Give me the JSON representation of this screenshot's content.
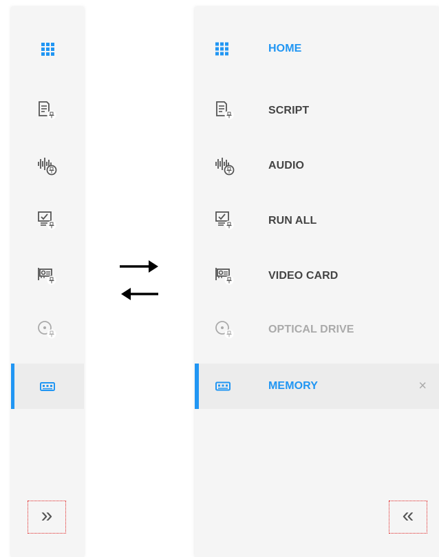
{
  "collapsed_sidebar": {
    "items": [
      {
        "icon": "grid-icon"
      },
      {
        "icon": "script-icon"
      },
      {
        "icon": "audio-icon"
      },
      {
        "icon": "run-all-icon"
      },
      {
        "icon": "video-card-icon"
      },
      {
        "icon": "optical-drive-icon"
      },
      {
        "icon": "memory-icon",
        "active": true
      }
    ],
    "toggle": {
      "glyph": "»",
      "icon": "expand-icon"
    }
  },
  "expanded_sidebar": {
    "items": [
      {
        "label": "HOME",
        "icon": "grid-icon"
      },
      {
        "label": "SCRIPT",
        "icon": "script-icon"
      },
      {
        "label": "AUDIO",
        "icon": "audio-icon"
      },
      {
        "label": "RUN ALL",
        "icon": "run-all-icon"
      },
      {
        "label": "VIDEO CARD",
        "icon": "video-card-icon"
      },
      {
        "label": "OPTICAL DRIVE",
        "icon": "optical-drive-icon",
        "disabled": true
      },
      {
        "label": "MEMORY",
        "icon": "memory-icon",
        "active": true,
        "close": "×"
      }
    ],
    "toggle": {
      "glyph": "«",
      "icon": "collapse-icon"
    }
  },
  "colors": {
    "accent": "#2196f3",
    "text": "#444444",
    "disabled": "#aaaaaa",
    "panel": "#f5f5f5",
    "toggle_border": "#e02020"
  }
}
